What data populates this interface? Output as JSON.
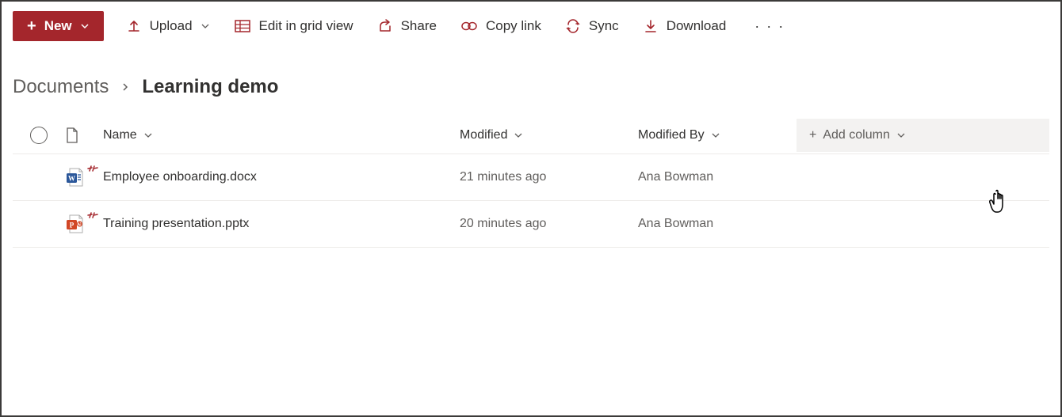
{
  "toolbar": {
    "new_label": "New",
    "upload_label": "Upload",
    "edit_grid_label": "Edit in grid view",
    "share_label": "Share",
    "copylink_label": "Copy link",
    "sync_label": "Sync",
    "download_label": "Download"
  },
  "breadcrumb": {
    "root": "Documents",
    "current": "Learning demo"
  },
  "columns": {
    "name": "Name",
    "modified": "Modified",
    "modified_by": "Modified By",
    "add_column": "Add column"
  },
  "files": [
    {
      "type": "docx",
      "name": "Employee onboarding.docx",
      "modified": "21 minutes ago",
      "modified_by": "Ana Bowman"
    },
    {
      "type": "pptx",
      "name": "Training presentation.pptx",
      "modified": "20 minutes ago",
      "modified_by": "Ana Bowman"
    }
  ]
}
